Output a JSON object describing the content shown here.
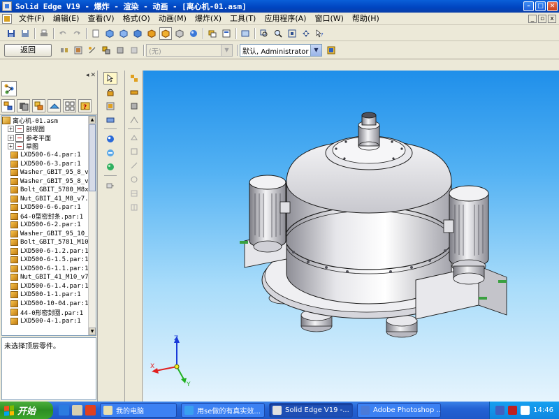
{
  "window": {
    "title": "Solid Edge V19 - 爆炸 - 渲染 - 动画 - [离心机-01.asm]"
  },
  "menu": [
    "文件(F)",
    "编辑(E)",
    "查看(V)",
    "格式(O)",
    "动画(M)",
    "爆炸(X)",
    "工具(T)",
    "应用程序(A)",
    "窗口(W)",
    "帮助(H)"
  ],
  "toolbar2": {
    "back_label": "返回",
    "style_value": "(无)",
    "user_value": "默认, Administrator"
  },
  "tree": {
    "root": "离心机-01.asm",
    "nodes": [
      "剖视图",
      "参考平面",
      "草图"
    ],
    "items": [
      "LXD500-6-4.par:1",
      "LXD500-6-3.par:1",
      "Washer_GBIT_95_8_v",
      "Washer_GBIT_95_8_v",
      "Bolt_GBIT_5780_M8x",
      "Nut_GBIT_41_M8_v7.",
      "LXD500-6-6.par:1",
      "64-0型密封条.par:1",
      "LXD500-6-2.par:1",
      "Washer_GBIT_95_10_",
      "Bolt_GBIT_5781_M10",
      "LXD500-6-1.2.par:1",
      "LXD500-6-1.5.par:1",
      "LXD500-6-1.1.par:1",
      "Nut_GBIT_41_M10_v7",
      "LXD500-6-1.4.par:1",
      "LXD500-1-1.par:1",
      "LXD500-10-04.par:1",
      "44-0形密封圈.par:1",
      "LXD500-4-1.par:1"
    ]
  },
  "status_text": "未选择顶层零件。",
  "triad": {
    "x": "X",
    "y": "Y",
    "z": "Z"
  },
  "taskbar": {
    "start": "开始",
    "tasks": [
      "我的电脑",
      "用se做的有真实效...",
      "Solid Edge V19 -...",
      "Adobe Photoshop ..."
    ],
    "clock": "14:46"
  }
}
